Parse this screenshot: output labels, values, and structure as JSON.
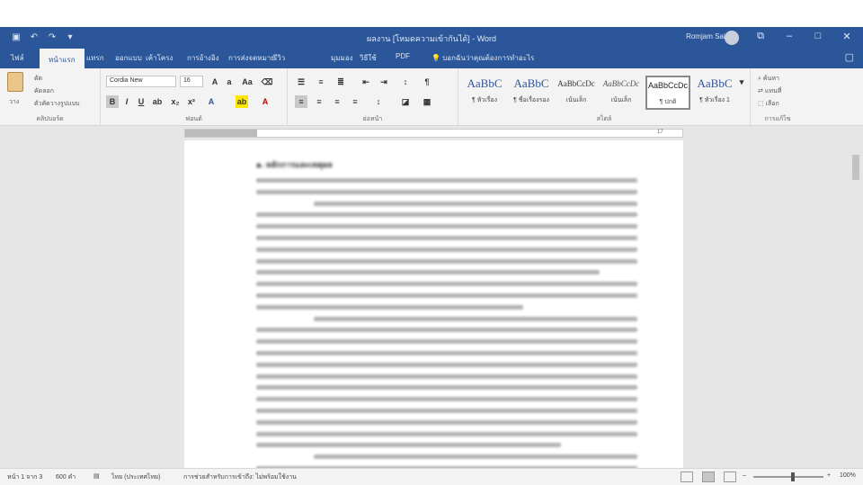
{
  "titlebar": {
    "doc_title": "ผลงาน [โหมดความเข้ากันได้] - Word",
    "user_name": "Romjam Saipan",
    "qa_icons": [
      "save-icon",
      "undo-icon",
      "redo-icon",
      "customize-icon"
    ],
    "window_icons": [
      "ribbon-options-icon",
      "minimize-icon",
      "maximize-icon",
      "close-icon"
    ]
  },
  "tabs": {
    "file": "ไฟล์",
    "home": "หน้าแรก",
    "insert": "แทรก",
    "design": "ออกแบบ",
    "layout": "เค้าโครง",
    "references": "การอ้างอิง",
    "mailings": "การส่งจดหมาย",
    "review": "รีวิว",
    "view": "มุมมอง",
    "help": "วิธีใช้",
    "tell_me": "บอกฉันว่าคุณต้องการทำอะไร"
  },
  "ribbon": {
    "clipboard": {
      "paste": "วาง",
      "cut": "ตัด",
      "copy": "คัดลอก",
      "format_painter": "ตัวคัดวางรูปแบบ",
      "label": "คลิปบอร์ด"
    },
    "font": {
      "name": "Cordia New",
      "size": "16",
      "label": "ฟอนต์"
    },
    "paragraph": {
      "label": "ย่อหน้า"
    },
    "styles": {
      "label": "สไตล์",
      "items": [
        {
          "preview": "AaBbC",
          "name": "¶ หัวเรื่อง"
        },
        {
          "preview": "AaBbC",
          "name": "¶ ชื่อเรื่องรอง"
        },
        {
          "preview": "AaBbCcDc",
          "name": "เน้นเล็ก"
        },
        {
          "preview": "AaBbCcDc",
          "name": "เน้นเล็ก"
        },
        {
          "preview": "AaBbCcDc",
          "name": "¶ ปกติ"
        },
        {
          "preview": "AaBbC",
          "name": "¶ หัวเรื่อง 1"
        }
      ]
    },
    "editing": {
      "find": "ค้นหา",
      "replace": "แทนที่",
      "select": "เลือก",
      "label": "การแก้ไข"
    }
  },
  "ruler": {
    "marker": "17"
  },
  "document": {
    "heading": "๑. หลักการและเหตุผล"
  },
  "status": {
    "page": "หน้า 1 จาก 3",
    "words": "600 คำ",
    "language": "ไทย (ประเทศไทย)",
    "accessibility": "การช่วยสำหรับการเข้าถึง: ไม่พร้อมใช้งาน",
    "zoom": "100%"
  }
}
